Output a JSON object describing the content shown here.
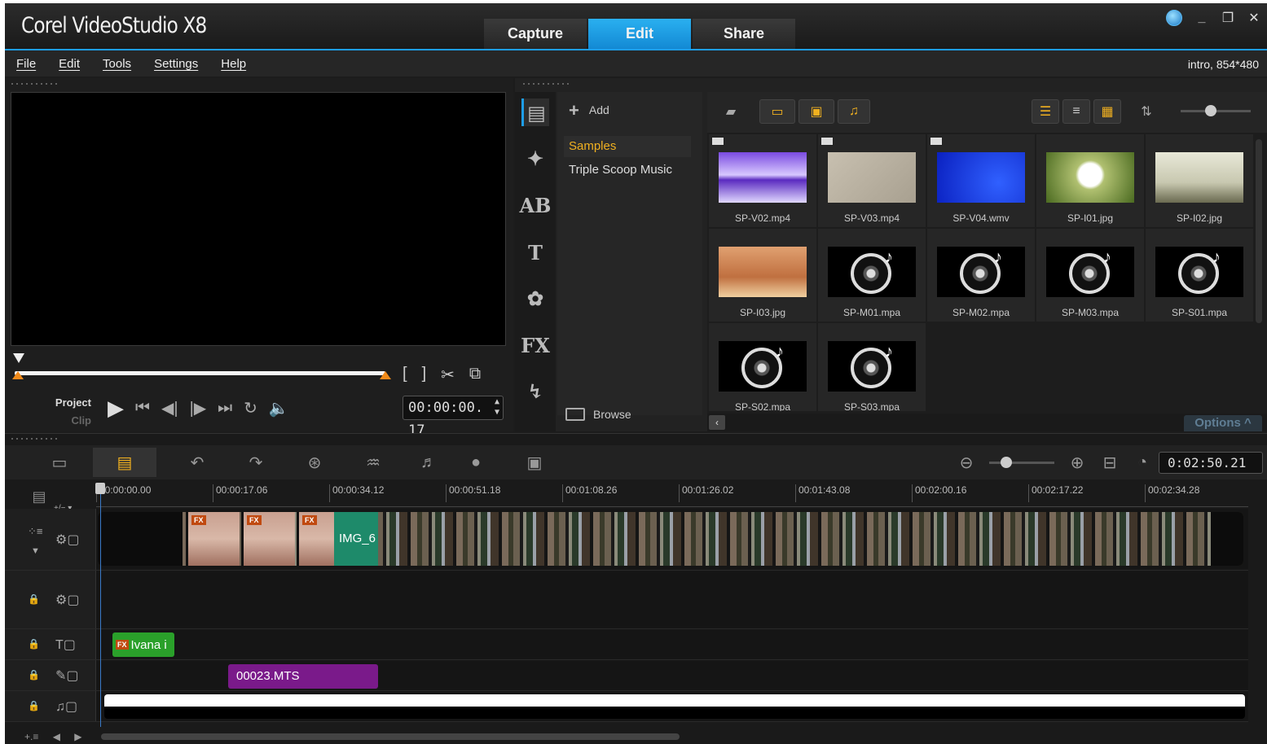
{
  "app": {
    "title": "Corel VideoStudio X8"
  },
  "tabs": [
    {
      "label": "Capture",
      "active": false
    },
    {
      "label": "Edit",
      "active": true
    },
    {
      "label": "Share",
      "active": false
    }
  ],
  "window_controls": [
    "globe-icon",
    "minimize-icon",
    "restore-icon",
    "close-icon"
  ],
  "menu": [
    "File",
    "Edit",
    "Tools",
    "Settings",
    "Help"
  ],
  "project_info": "intro, 854*480",
  "player": {
    "project_label": "Project",
    "clip_label": "Clip",
    "timecode": "00:00:00. 17",
    "trim_buttons": [
      "[",
      "]",
      "✂",
      "⧉"
    ],
    "transport": [
      "play",
      "home",
      "previous-frame",
      "next-frame",
      "end",
      "repeat",
      "volume"
    ]
  },
  "library": {
    "add_label": "Add",
    "folders": [
      {
        "label": "Samples",
        "active": true
      },
      {
        "label": "Triple Scoop Music",
        "active": false
      }
    ],
    "browse_label": "Browse",
    "options_label": "Options",
    "items": [
      {
        "label": "SP-V02.mp4",
        "kind": "video"
      },
      {
        "label": "SP-V03.mp4",
        "kind": "video"
      },
      {
        "label": "SP-V04.wmv",
        "kind": "video"
      },
      {
        "label": "SP-I01.jpg",
        "kind": "image"
      },
      {
        "label": "SP-I02.jpg",
        "kind": "image"
      },
      {
        "label": "SP-I03.jpg",
        "kind": "image"
      },
      {
        "label": "SP-M01.mpa",
        "kind": "audio"
      },
      {
        "label": "SP-M02.mpa",
        "kind": "audio"
      },
      {
        "label": "SP-M03.mpa",
        "kind": "audio"
      },
      {
        "label": "SP-S01.mpa",
        "kind": "audio"
      },
      {
        "label": "SP-S02.mpa",
        "kind": "audio"
      },
      {
        "label": "SP-S03.mpa",
        "kind": "audio"
      }
    ]
  },
  "timeline": {
    "timecode": "0:02:50.21",
    "track_adjust_label": "+/− ▾",
    "ruler": [
      "00:00:00.00",
      "00:00:17.06",
      "00:00:34.12",
      "00:00:51.18",
      "00:01:08.26",
      "00:01:26.02",
      "00:01:43.08",
      "00:02:00.16",
      "00:02:17.22",
      "00:02:34.28"
    ],
    "image_clip": "IMG_6",
    "title_clip": "Ivana i",
    "voice_clip": "00023.MTS",
    "fx_label": "FX"
  },
  "colors": {
    "accent": "#1e9ee8",
    "highlight": "#f0b020",
    "title_clip": "#2aa02a",
    "voice_clip": "#7a1a8a",
    "image_clip": "#1e8a6a"
  }
}
